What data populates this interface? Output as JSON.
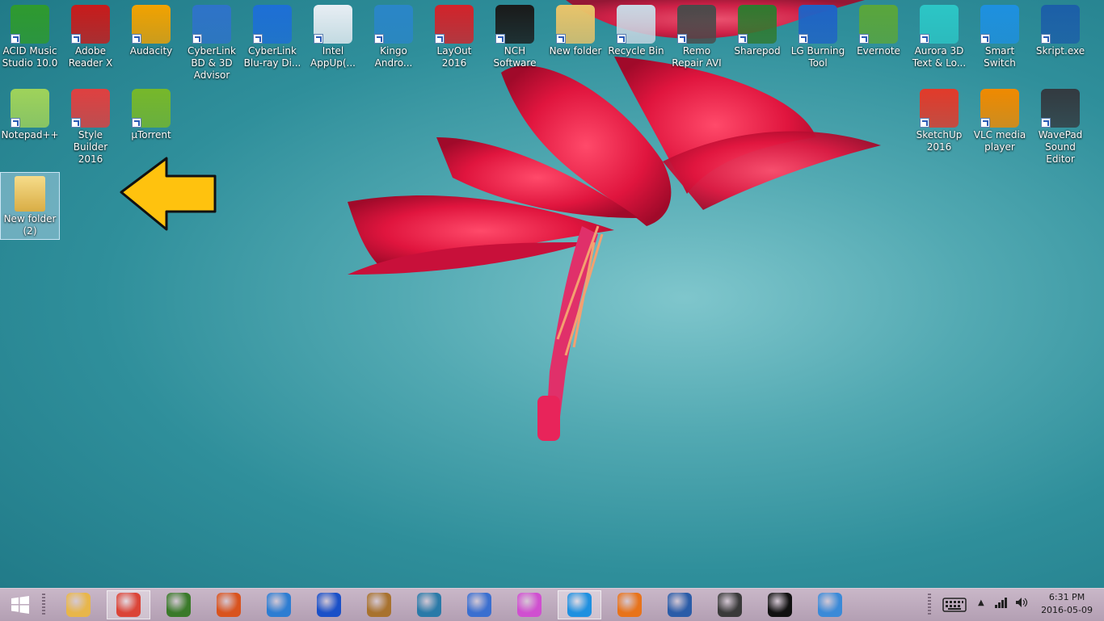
{
  "desktop": {
    "icons": [
      {
        "label": "ACID Music Studio 10.0",
        "icon": "acid-music-icon",
        "color": "#2e9a2e"
      },
      {
        "label": "Adobe Reader X",
        "icon": "adobe-reader-icon",
        "color": "#c81b1b"
      },
      {
        "label": "Audacity",
        "icon": "audacity-icon",
        "color": "#f2a200"
      },
      {
        "label": "CyberLink BD & 3D Advisor",
        "icon": "cyberlink-bd-icon",
        "color": "#2e73c9"
      },
      {
        "label": "CyberLink Blu-ray Di...",
        "icon": "cyberlink-bluray-icon",
        "color": "#1d6fd6"
      },
      {
        "label": "Intel AppUp(...",
        "icon": "intel-appup-icon",
        "color": "#e8eef4"
      },
      {
        "label": "Kingo Andro...",
        "icon": "kingo-android-icon",
        "color": "#2a86c8"
      },
      {
        "label": "LayOut 2016",
        "icon": "layout-icon",
        "color": "#d2232a"
      },
      {
        "label": "NCH Software",
        "icon": "nch-software-icon",
        "color": "#1a1a1a"
      },
      {
        "label": "New folder",
        "icon": "folder-icon",
        "color": "#e9c46a"
      },
      {
        "label": "Recycle Bin",
        "icon": "recycle-bin-icon",
        "color": "#c9d8e4"
      },
      {
        "label": "Remo Repair AVI",
        "icon": "remo-repair-icon",
        "color": "#4a4a4a"
      },
      {
        "label": "Sharepod",
        "icon": "sharepod-icon",
        "color": "#2f7a2f"
      },
      {
        "label": "LG Burning Tool",
        "icon": "lg-burning-icon",
        "color": "#1f63c6"
      },
      {
        "label": "Evernote",
        "icon": "evernote-icon",
        "color": "#5aa63b"
      },
      {
        "label": "Aurora 3D Text & Lo...",
        "icon": "aurora-3d-icon",
        "color": "#2cc6c6"
      },
      {
        "label": "Smart Switch",
        "icon": "smart-switch-icon",
        "color": "#1e90e0"
      },
      {
        "label": "Skript.exe",
        "icon": "skript-icon",
        "color": "#1c5fa8"
      }
    ],
    "icons_row2_left": [
      {
        "label": "Notepad++",
        "icon": "notepad-plus-icon",
        "color": "#9fd35a"
      },
      {
        "label": "Style Builder 2016",
        "icon": "style-builder-icon",
        "color": "#e04040"
      },
      {
        "label": "µTorrent",
        "icon": "utorrent-icon",
        "color": "#77b82a"
      }
    ],
    "icons_row2_right": [
      {
        "label": "SketchUp 2016",
        "icon": "sketchup-icon",
        "color": "#e23a2a"
      },
      {
        "label": "VLC media player",
        "icon": "vlc-icon",
        "color": "#f08a00"
      },
      {
        "label": "WavePad Sound Editor",
        "icon": "wavepad-icon",
        "color": "#333a40"
      }
    ],
    "selected_icon": {
      "label": "New folder (2)",
      "icon": "folder-icon",
      "color": "#e9c46a"
    }
  },
  "taskbar": {
    "apps": [
      {
        "icon": "file-explorer-icon",
        "color": "#e8b64a",
        "active": false
      },
      {
        "icon": "chrome-icon",
        "color": "#db4437",
        "active": true
      },
      {
        "icon": "wondershare-icon",
        "color": "#3a7a2a",
        "active": false
      },
      {
        "icon": "office-tiles-icon",
        "color": "#d9531e",
        "active": false
      },
      {
        "icon": "media-player-icon",
        "color": "#2d7dd2",
        "active": false
      },
      {
        "icon": "malwarebytes-icon",
        "color": "#1a50c8",
        "active": false
      },
      {
        "icon": "bank-icon",
        "color": "#a8722e",
        "active": false
      },
      {
        "icon": "video-film-icon",
        "color": "#2a7aa8",
        "active": false
      },
      {
        "icon": "camera-eye-icon",
        "color": "#3a6fd0",
        "active": false
      },
      {
        "icon": "itunes-icon",
        "color": "#d04fd0",
        "active": false
      },
      {
        "icon": "skype-icon",
        "color": "#1e90e0",
        "active": true
      },
      {
        "icon": "firefox-icon",
        "color": "#e8731a",
        "active": false
      },
      {
        "icon": "remote-desktop-icon",
        "color": "#2a5ca8",
        "active": false
      },
      {
        "icon": "hypercam-icon",
        "color": "#3a3a3a",
        "active": false
      },
      {
        "icon": "play-circle-icon",
        "color": "#111111",
        "active": false
      },
      {
        "icon": "safari-compass-icon",
        "color": "#3a8ad8",
        "active": false
      }
    ],
    "clock": {
      "time": "6:31 PM",
      "date": "2016-05-09"
    }
  }
}
